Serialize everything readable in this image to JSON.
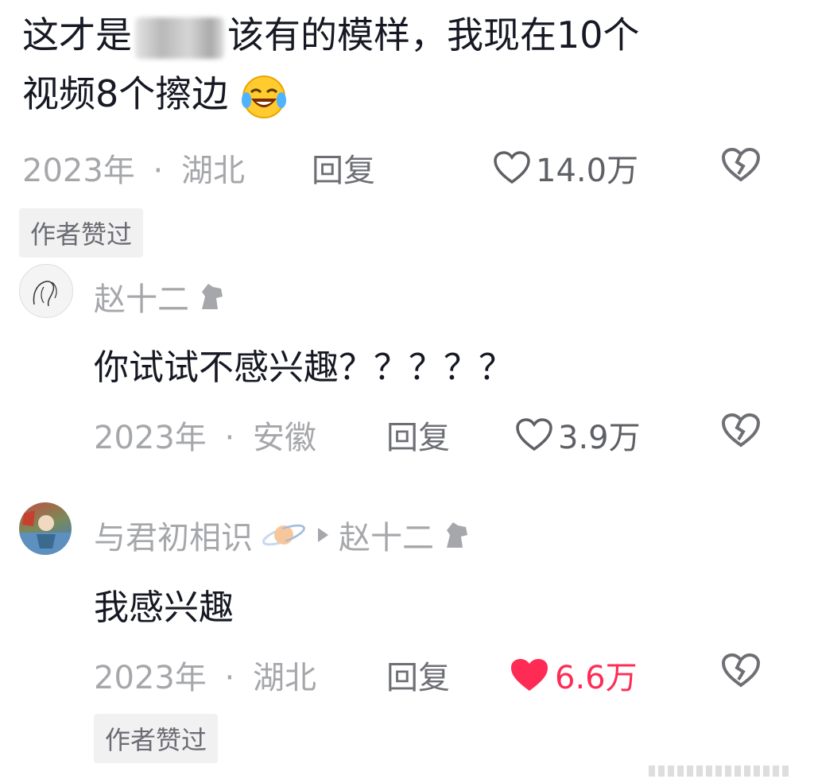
{
  "comment": {
    "text_line1_a": "这才是",
    "text_line1_b": "该有的模样，我现在10个",
    "text_line2": "视频8个擦边",
    "emoji": "laughing-crying-emoji",
    "time": "2023年",
    "sep": "·",
    "location": "湖北",
    "reply_label": "回复",
    "likes": "14.0万",
    "badge": "作者赞过"
  },
  "replies": [
    {
      "username": "赵十二",
      "user_icon": "horse-icon",
      "text": "你试试不感兴趣？？？？？",
      "time": "2023年",
      "sep": "·",
      "location": "安徽",
      "reply_label": "回复",
      "likes": "3.9万",
      "liked": false
    },
    {
      "username": "与君初相识",
      "user_icon": "planet-icon",
      "reply_to": "赵十二",
      "reply_to_icon": "horse-icon",
      "text": "我感兴趣",
      "time": "2023年",
      "sep": "·",
      "location": "湖北",
      "reply_label": "回复",
      "likes": "6.6万",
      "liked": true,
      "badge": "作者赞过"
    }
  ],
  "colors": {
    "accent_like": "#fe2c55",
    "meta": "#a6a7ab",
    "text": "#161823"
  }
}
